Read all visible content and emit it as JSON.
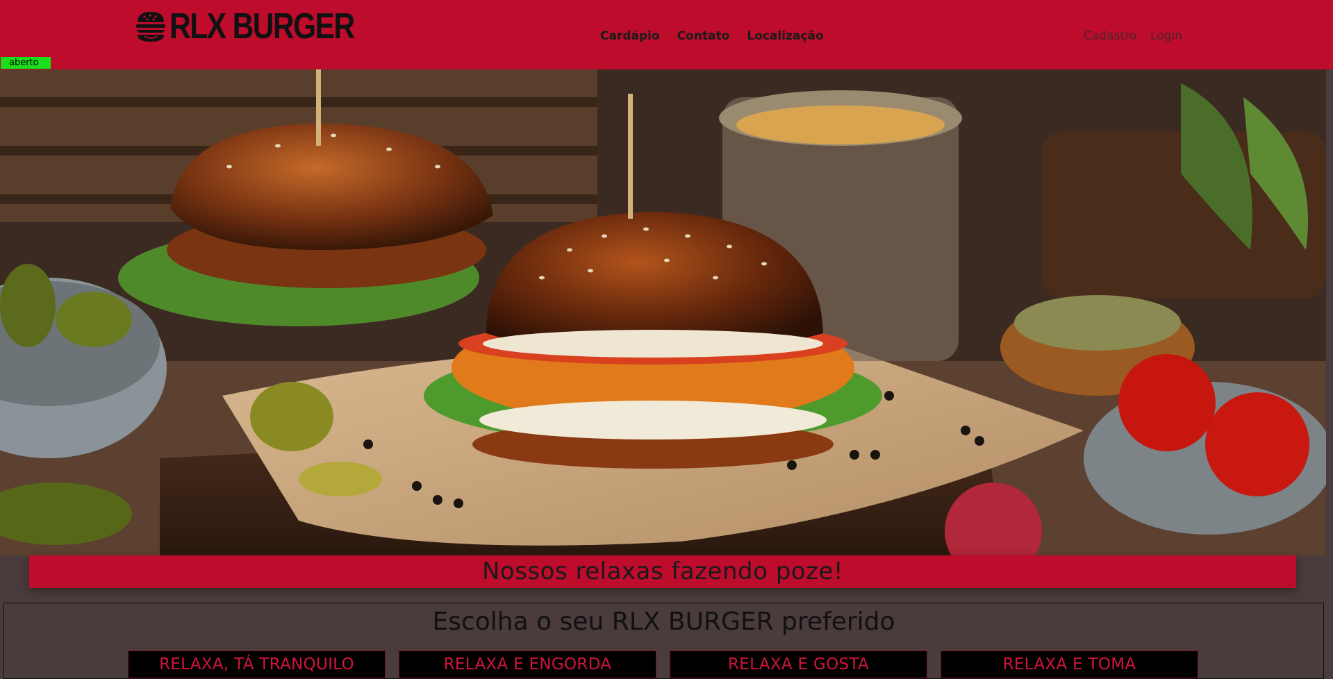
{
  "header": {
    "logo_text": "RLX BURGER",
    "nav": {
      "menu": "Cardápio",
      "contact": "Contato",
      "location": "Localização"
    },
    "account": {
      "signup": "Cadastro",
      "login": "Login"
    },
    "status": "aberto"
  },
  "caption": "Nossos relaxas fazendo poze!",
  "menu_section": {
    "title": "Escolha o seu RLX BURGER preferido",
    "options": [
      {
        "label": "RELAXA, TÁ TRANQUILO"
      },
      {
        "label": "RELAXA E ENGORDA"
      },
      {
        "label": "RELAXA E GOSTA"
      },
      {
        "label": "RELAXA E TOMA"
      }
    ]
  },
  "colors": {
    "brand_red": "#bd0c2c",
    "status_green": "#19e01a",
    "page_background": "#4a3b3c"
  },
  "icons": {
    "logo": "burger-icon"
  }
}
